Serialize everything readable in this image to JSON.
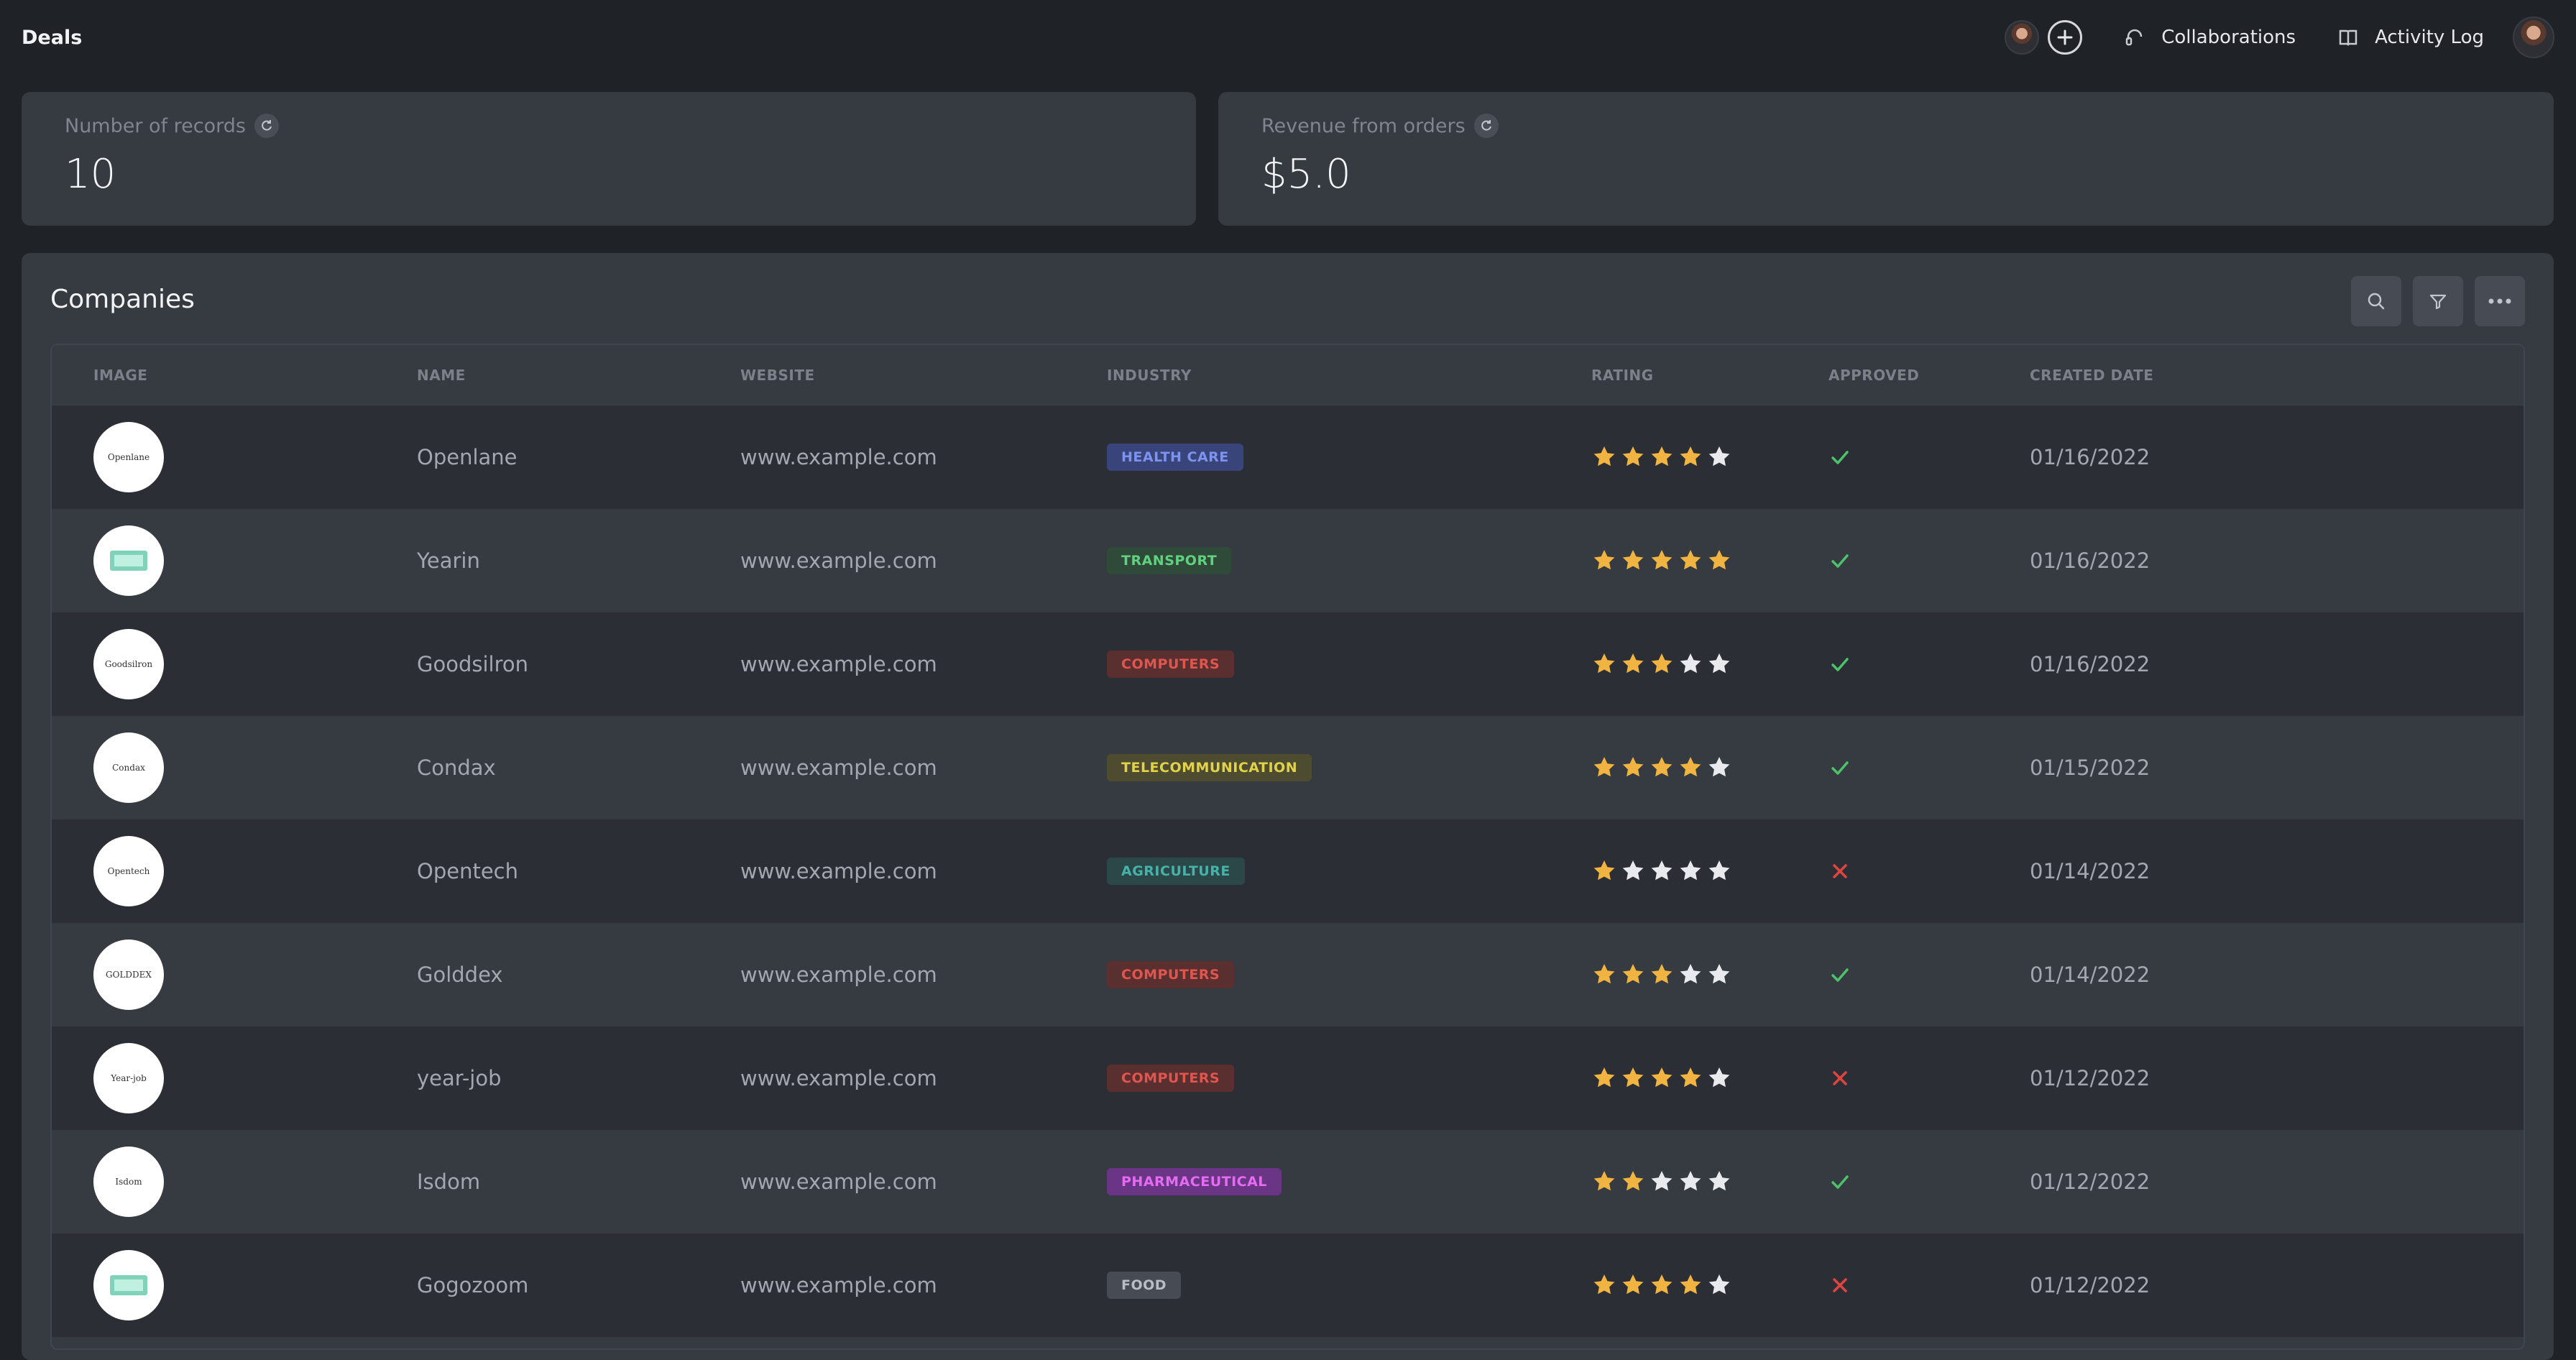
{
  "header": {
    "title": "Deals",
    "collaborations_label": "Collaborations",
    "activity_log_label": "Activity Log"
  },
  "stats": {
    "records": {
      "label": "Number of records",
      "value": "10"
    },
    "revenue": {
      "label": "Revenue from orders",
      "value": "$5.0"
    }
  },
  "companies": {
    "title": "Companies",
    "columns": [
      "IMAGE",
      "NAME",
      "WEBSITE",
      "INDUSTRY",
      "RATING",
      "APPROVED",
      "CREATED DATE"
    ],
    "rows": [
      {
        "logo": "Openlane",
        "name": "Openlane",
        "website": "www.example.com",
        "industry": "HEALTH CARE",
        "rating": 4,
        "approved": true,
        "created": "01/16/2022"
      },
      {
        "logo": "",
        "name": "Yearin",
        "website": "www.example.com",
        "industry": "TRANSPORT",
        "rating": 5,
        "approved": true,
        "created": "01/16/2022"
      },
      {
        "logo": "Goodsilron",
        "name": "Goodsilron",
        "website": "www.example.com",
        "industry": "COMPUTERS",
        "rating": 3,
        "approved": true,
        "created": "01/16/2022"
      },
      {
        "logo": "Condax",
        "name": "Condax",
        "website": "www.example.com",
        "industry": "TELECOMMUNICATION",
        "rating": 4,
        "approved": true,
        "created": "01/15/2022"
      },
      {
        "logo": "Opentech",
        "name": "Opentech",
        "website": "www.example.com",
        "industry": "AGRICULTURE",
        "rating": 1,
        "approved": false,
        "created": "01/14/2022"
      },
      {
        "logo": "GOLDDEX",
        "name": "Golddex",
        "website": "www.example.com",
        "industry": "COMPUTERS",
        "rating": 3,
        "approved": true,
        "created": "01/14/2022"
      },
      {
        "logo": "Year-job",
        "name": "year-job",
        "website": "www.example.com",
        "industry": "COMPUTERS",
        "rating": 4,
        "approved": false,
        "created": "01/12/2022"
      },
      {
        "logo": "Isdom",
        "name": "Isdom",
        "website": "www.example.com",
        "industry": "PHARMACEUTICAL",
        "rating": 2,
        "approved": true,
        "created": "01/12/2022"
      },
      {
        "logo": "",
        "name": "Gogozoom",
        "website": "www.example.com",
        "industry": "FOOD",
        "rating": 4,
        "approved": false,
        "created": "01/12/2022"
      }
    ]
  },
  "tag_colors": {
    "HEALTH CARE": {
      "bg": "#39457a",
      "fg": "#7c93f0"
    },
    "TRANSPORT": {
      "bg": "#2f4a38",
      "fg": "#5fd17f"
    },
    "COMPUTERS": {
      "bg": "#5a2f2f",
      "fg": "#e0564f"
    },
    "TELECOMMUNICATION": {
      "bg": "#4d4c30",
      "fg": "#e2d24a"
    },
    "AGRICULTURE": {
      "bg": "#2c4747",
      "fg": "#45b3a9"
    },
    "PHARMACEUTICAL": {
      "bg": "#6a3585",
      "fg": "#e56cf2"
    },
    "FOOD": {
      "bg": "#474b53",
      "fg": "#b9bdc4"
    }
  },
  "colors": {
    "star_filled": "#f2b441",
    "star_empty": "#e8eaee",
    "check": "#4cc26a",
    "cross": "#e0443e"
  }
}
